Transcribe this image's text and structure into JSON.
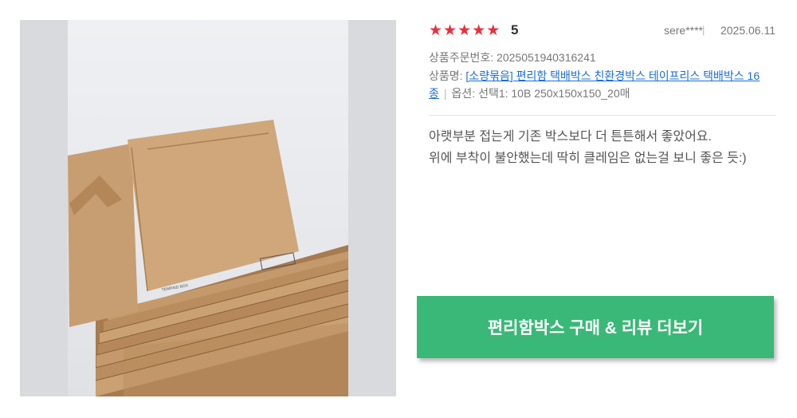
{
  "review": {
    "rating_stars": 5,
    "score": "5",
    "user": "sere****",
    "separator": "|",
    "date": "2025.06.11",
    "order_label": "상품주문번호: 2025051940316241",
    "product_label": "상품명: ",
    "product_link": "[소량묶음] 편리함 택배박스 친환경박스 테이프리스 택배박스 16종",
    "option_text": "옵션: 선택1: 10B 250x150x150_20매",
    "body_line1": "아랫부분 접는게 기존 박스보다 더 튼튼해서 좋았어요.",
    "body_line2": "위에 부착이 불안했는데 딱히 클레임은 없는걸 보니 좋은 듯:)"
  },
  "cta": {
    "label": "편리함박스 구매 & 리뷰 더보기"
  },
  "colors": {
    "star": "#e8303d",
    "cta_bg": "#3ab877",
    "link": "#1a6fd6"
  }
}
